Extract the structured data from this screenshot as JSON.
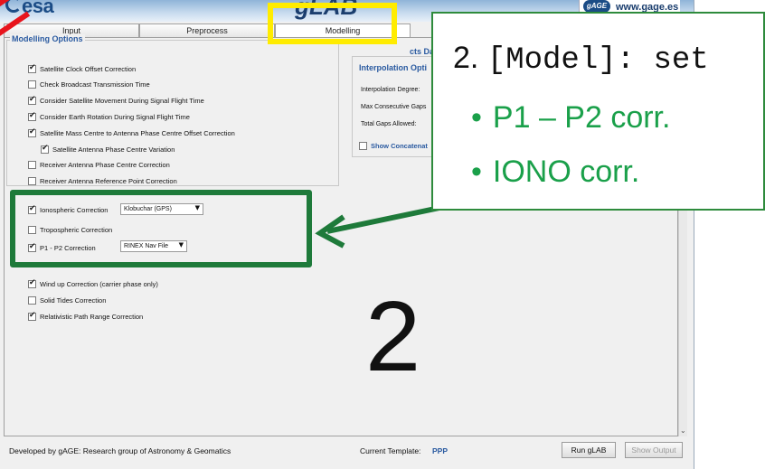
{
  "header": {
    "esa_logo": "esa",
    "app_title": "gLAB",
    "gage_badge": "gAGE",
    "gage_url": "www.gage.es"
  },
  "tabs": [
    {
      "label": "Input"
    },
    {
      "label": "Preprocess"
    },
    {
      "label": "Modelling",
      "active": true
    }
  ],
  "modelling": {
    "title": "Modelling Options",
    "options": [
      {
        "label": "Satellite Clock Offset Correction",
        "checked": true
      },
      {
        "label": "Check Broadcast Transmission Time",
        "checked": false
      },
      {
        "label": "Consider Satellite Movement During Signal Flight Time",
        "checked": true
      },
      {
        "label": "Consider Earth Rotation During Signal Flight Time",
        "checked": true
      },
      {
        "label": "Satellite Mass Centre to Antenna Phase Centre Offset Correction",
        "checked": true
      },
      {
        "label": "Satellite Antenna Phase Centre Variation",
        "checked": true
      },
      {
        "label": "Receiver Antenna Phase Centre Correction",
        "checked": false
      },
      {
        "label": "Receiver Antenna Reference Point Correction",
        "checked": false
      }
    ],
    "iono": {
      "label": "Ionospheric Correction",
      "checked": true,
      "value": "Klobuchar (GPS)"
    },
    "tropo": {
      "label": "Tropospheric Correction",
      "checked": false
    },
    "p1p2": {
      "label": "P1 - P2 Correction",
      "checked": true,
      "value": "RINEX Nav File"
    },
    "more_options": [
      {
        "label": "Wind up Correction (carrier phase only)",
        "checked": true
      },
      {
        "label": "Solid Tides Correction",
        "checked": false
      },
      {
        "label": "Relativistic Path Range Correction",
        "checked": true
      }
    ]
  },
  "right_panel": {
    "products_partial": "cts Da",
    "interp_title": "Interpolation Opti",
    "interp_degree": "Interpolation Degree:",
    "max_gaps": "Max Consecutive Gaps",
    "total_gaps": "Total Gaps Allowed:",
    "show_concat": "Show Concatenat"
  },
  "footer": {
    "developed_by": "Developed by gAGE: Research group of Astronomy & Geomatics",
    "template_label": "Current Template:",
    "template_value": "PPP",
    "run_button": "Run gLAB",
    "show_output_button": "Show Output"
  },
  "annotation": {
    "step_number": "2.",
    "step_code": "[Model]: set",
    "bullet_dot": "•",
    "bullets": [
      "P1 – P2 corr.",
      "IONO corr."
    ],
    "big_number": "2"
  },
  "colors": {
    "highlight_yellow": "#ffec00",
    "highlight_green": "#1e7a3a",
    "bullet_green": "#1aa04a",
    "annotation_red": "#e8141c",
    "group_title_blue": "#2a5aa0"
  }
}
